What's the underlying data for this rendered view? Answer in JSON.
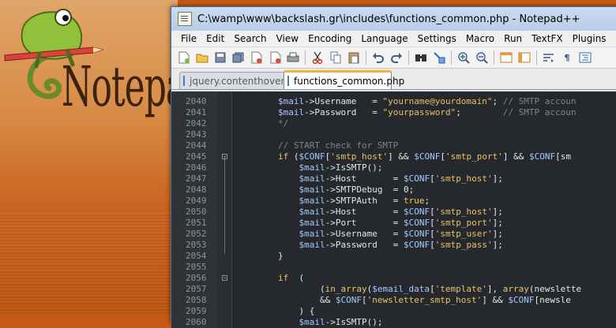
{
  "brand": {
    "logo_text": "Notepad++"
  },
  "window": {
    "title": "C:\\wamp\\www\\backslash.gr\\includes\\functions_common.php - Notepad++"
  },
  "menu": [
    "File",
    "Edit",
    "Search",
    "View",
    "Encoding",
    "Language",
    "Settings",
    "Macro",
    "Run",
    "TextFX",
    "Plugins",
    "Windo"
  ],
  "toolbar_icons": [
    "new-file-icon",
    "open-file-icon",
    "save-icon",
    "save-all-icon",
    "close-icon",
    "close-all-icon",
    "print-icon",
    "cut-icon",
    "copy-icon",
    "paste-icon",
    "undo-icon",
    "redo-icon",
    "find-icon",
    "replace-icon",
    "zoom-in-icon",
    "zoom-out-icon",
    "sync-v-icon",
    "sync-h-icon",
    "word-wrap-icon",
    "show-all-chars-icon",
    "indent-guide-icon"
  ],
  "tabs": [
    {
      "label": "jquery.contenthover.js",
      "active": false
    },
    {
      "label": "functions_common.php",
      "active": true
    }
  ],
  "colors": {
    "editor_bg": "#25292e",
    "string": "#e8c06a",
    "variable": "#a6c8ff",
    "comment": "#7a858f",
    "tab_accent": "#f6b33a"
  },
  "lines": [
    {
      "num": "2040",
      "text": "        $mail->Username   = \"yourname@yourdomain\"; // SMTP accoun"
    },
    {
      "num": "2041",
      "text": "        $mail->Password   = \"yourpassword\";        // SMTP accoun"
    },
    {
      "num": "2042",
      "text": "        */"
    },
    {
      "num": "2043",
      "text": ""
    },
    {
      "num": "2044",
      "text": "        // START check for SMTP"
    },
    {
      "num": "2045",
      "text": "        if ($CONF['smtp_host'] && $CONF['smtp_port'] && $CONF['sm"
    },
    {
      "num": "2046",
      "text": "            $mail->IsSMTP();"
    },
    {
      "num": "2047",
      "text": "            $mail->Host       = $CONF['smtp_host'];"
    },
    {
      "num": "2048",
      "text": "            $mail->SMTPDebug  = 0;"
    },
    {
      "num": "2049",
      "text": "            $mail->SMTPAuth   = true;"
    },
    {
      "num": "2050",
      "text": "            $mail->Host       = $CONF['smtp_host'];"
    },
    {
      "num": "2051",
      "text": "            $mail->Port       = $CONF['smtp_port'];"
    },
    {
      "num": "2052",
      "text": "            $mail->Username   = $CONF['smtp_user'];"
    },
    {
      "num": "2053",
      "text": "            $mail->Password   = $CONF['smtp_pass'];"
    },
    {
      "num": "2054",
      "text": "        }"
    },
    {
      "num": "2055",
      "text": ""
    },
    {
      "num": "2056",
      "text": "        if  ("
    },
    {
      "num": "2057",
      "text": "                (in_array($email_data['template'], array('newslette"
    },
    {
      "num": "2058",
      "text": "                && $CONF['newsletter_smtp_host'] && $CONF['newsle"
    },
    {
      "num": "2059",
      "text": "            ) {"
    },
    {
      "num": "2060",
      "text": "            $mail->IsSMTP();"
    }
  ]
}
